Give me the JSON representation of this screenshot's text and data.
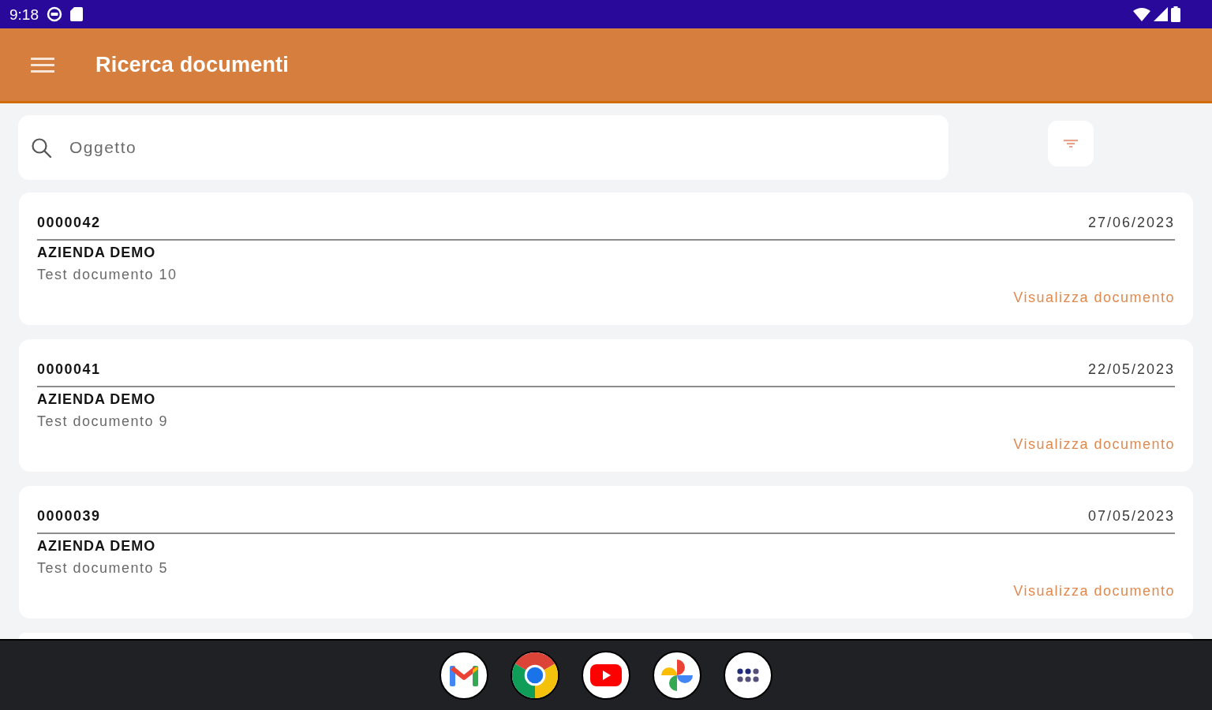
{
  "status_bar": {
    "time": "9:18"
  },
  "app_bar": {
    "title": "Ricerca documenti"
  },
  "search": {
    "placeholder": "Oggetto"
  },
  "documents": [
    {
      "number": "0000042",
      "date": "27/06/2023",
      "company": "AZIENDA DEMO",
      "description": "Test documento 10",
      "action": "Visualizza documento"
    },
    {
      "number": "0000041",
      "date": "22/05/2023",
      "company": "AZIENDA DEMO",
      "description": "Test documento 9",
      "action": "Visualizza documento"
    },
    {
      "number": "0000039",
      "date": "07/05/2023",
      "company": "AZIENDA DEMO",
      "description": "Test documento 5",
      "action": "Visualizza documento"
    }
  ]
}
